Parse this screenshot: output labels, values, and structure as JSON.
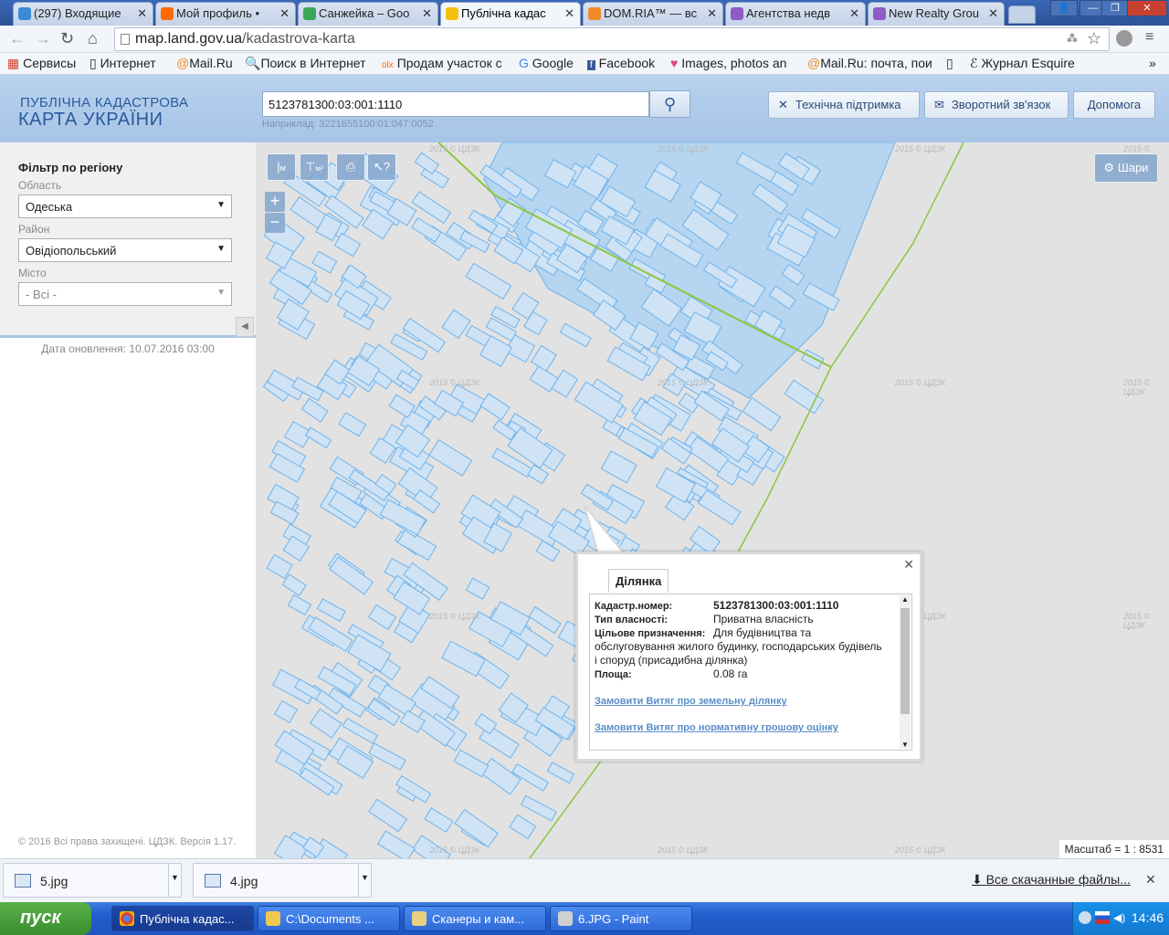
{
  "browser": {
    "tabs": [
      {
        "label": "(297) Входящие",
        "icon_color": "#3a8ad8",
        "active": false
      },
      {
        "label": "Мой профиль •",
        "icon_color": "#ff6a00",
        "active": false
      },
      {
        "label": "Санжейка – Goo",
        "icon_color": "#3aa757",
        "active": false
      },
      {
        "label": "Публічна кадас",
        "icon_color": "#f4c20d",
        "active": true
      },
      {
        "label": "DOM.RIA™ — вс",
        "icon_color": "#f08a24",
        "active": false
      },
      {
        "label": "Агентства недв",
        "icon_color": "#8e5cc4",
        "active": false
      },
      {
        "label": "New Realty Grou",
        "icon_color": "#8e5cc4",
        "active": false
      }
    ],
    "url_host": "map.land.gov.ua",
    "url_path": "/kadastrova-karta",
    "bookmarks": [
      "Сервисы",
      "Интернет",
      "Mail.Ru",
      "Поиск в Интернет",
      "Продам участок с",
      "Google",
      "Facebook",
      "Images, photos an",
      "Mail.Ru: почта, пои",
      "",
      "Журнал Esquire"
    ],
    "bookmarks_more": "»"
  },
  "site": {
    "logo_line1": "ПУБЛІЧНА КАДАСТРОВА",
    "logo_line2": "КАРТА УКРАЇНИ",
    "search_value": "5123781300:03:001:1110",
    "search_hint": "Наприклад: 3221655100:01:047:0052",
    "header_buttons": [
      "Технічна підтримка",
      "Зворотний зв'язок",
      "Допомога"
    ]
  },
  "sidebar": {
    "title": "Фільтр по регіону",
    "oblast_label": "Область",
    "oblast_value": "Одеська",
    "rayon_label": "Район",
    "rayon_value": "Овідіопольський",
    "misto_label": "Місто",
    "misto_value": "- Всі -",
    "update_date": "Дата оновлення: 10.07.2016 03:00",
    "copyright": "© 2016 Всі права захищені. ЦДЗК. Версія 1.17."
  },
  "map": {
    "layers_label": "Шари",
    "watermark": "2015 © ЦДЗК",
    "scale": "Масштаб = 1 : 8531",
    "tools": [
      "м",
      "м²"
    ],
    "popup": {
      "tab": "Ділянка",
      "fields": [
        {
          "k": "Кадастр.номер:",
          "v": "5123781300:03:001:1110"
        },
        {
          "k": "Тип власності:",
          "v": "Приватна власність"
        },
        {
          "k": "Цільове призначення:",
          "v": "Для будівництва та"
        }
      ],
      "purpose_cont1": "обслуговування жилого будинку, господарських будівель",
      "purpose_cont2": "і споруд (присадибна ділянка)",
      "area_k": "Площа:",
      "area_v": "0.08 га",
      "link1": "Замовити Витяг про земельну ділянку",
      "link2": "Замовити Витяг про нормативну грошову оцінку"
    }
  },
  "downloads": {
    "items": [
      "5.jpg",
      "4.jpg"
    ],
    "all_label": "Все скачанные файлы..."
  },
  "taskbar": {
    "start": "пуск",
    "tasks": [
      "Публічна кадас...",
      "C:\\Documents ...",
      "Сканеры и кам...",
      "6.JPG - Paint"
    ],
    "clock": "14:46"
  }
}
